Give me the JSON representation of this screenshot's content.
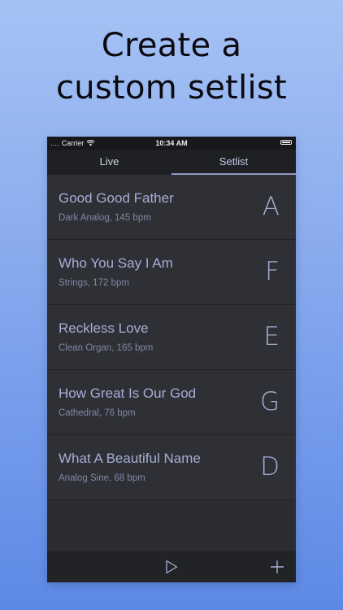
{
  "promo": {
    "line1": "Create a",
    "line2": "custom setlist"
  },
  "status_bar": {
    "signal": "․․․․",
    "carrier": "Carrier",
    "time": "10:34 AM"
  },
  "tabs": [
    {
      "label": "Live",
      "selected": false
    },
    {
      "label": "Setlist",
      "selected": true
    }
  ],
  "setlist": [
    {
      "title": "Good Good Father",
      "subtitle": "Dark Analog, 145 bpm",
      "key": "A"
    },
    {
      "title": "Who You Say I Am",
      "subtitle": "Strings, 172 bpm",
      "key": "F"
    },
    {
      "title": "Reckless Love",
      "subtitle": "Clean Organ, 165 bpm",
      "key": "E"
    },
    {
      "title": "How Great Is Our God",
      "subtitle": "Cathedral, 76 bpm",
      "key": "G"
    },
    {
      "title": "What A Beautiful Name",
      "subtitle": "Analog Sine, 68 bpm",
      "key": "D"
    }
  ],
  "toolbar": {
    "play_icon": "play-icon",
    "add_icon": "plus-icon"
  },
  "colors": {
    "accent": "#a6aed6",
    "background_top": "#a6c2f4",
    "background_bottom": "#5d89e6",
    "app_background": "#2e3035"
  }
}
